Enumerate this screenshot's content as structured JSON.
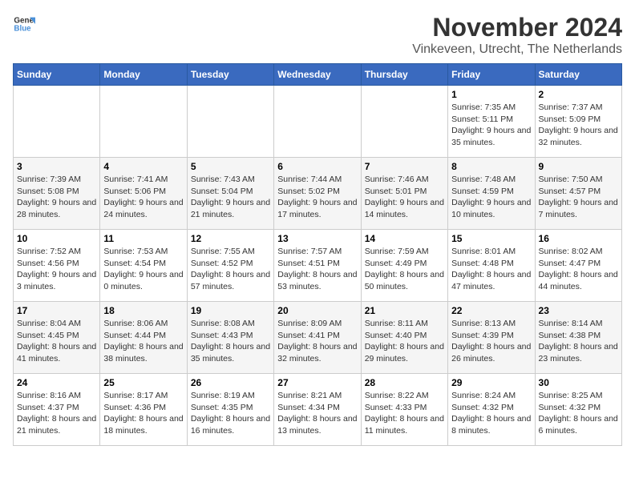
{
  "logo": {
    "general": "General",
    "blue": "Blue"
  },
  "title": "November 2024",
  "subtitle": "Vinkeveen, Utrecht, The Netherlands",
  "days_of_week": [
    "Sunday",
    "Monday",
    "Tuesday",
    "Wednesday",
    "Thursday",
    "Friday",
    "Saturday"
  ],
  "weeks": [
    [
      {
        "day": "",
        "info": ""
      },
      {
        "day": "",
        "info": ""
      },
      {
        "day": "",
        "info": ""
      },
      {
        "day": "",
        "info": ""
      },
      {
        "day": "",
        "info": ""
      },
      {
        "day": "1",
        "info": "Sunrise: 7:35 AM\nSunset: 5:11 PM\nDaylight: 9 hours and 35 minutes."
      },
      {
        "day": "2",
        "info": "Sunrise: 7:37 AM\nSunset: 5:09 PM\nDaylight: 9 hours and 32 minutes."
      }
    ],
    [
      {
        "day": "3",
        "info": "Sunrise: 7:39 AM\nSunset: 5:08 PM\nDaylight: 9 hours and 28 minutes."
      },
      {
        "day": "4",
        "info": "Sunrise: 7:41 AM\nSunset: 5:06 PM\nDaylight: 9 hours and 24 minutes."
      },
      {
        "day": "5",
        "info": "Sunrise: 7:43 AM\nSunset: 5:04 PM\nDaylight: 9 hours and 21 minutes."
      },
      {
        "day": "6",
        "info": "Sunrise: 7:44 AM\nSunset: 5:02 PM\nDaylight: 9 hours and 17 minutes."
      },
      {
        "day": "7",
        "info": "Sunrise: 7:46 AM\nSunset: 5:01 PM\nDaylight: 9 hours and 14 minutes."
      },
      {
        "day": "8",
        "info": "Sunrise: 7:48 AM\nSunset: 4:59 PM\nDaylight: 9 hours and 10 minutes."
      },
      {
        "day": "9",
        "info": "Sunrise: 7:50 AM\nSunset: 4:57 PM\nDaylight: 9 hours and 7 minutes."
      }
    ],
    [
      {
        "day": "10",
        "info": "Sunrise: 7:52 AM\nSunset: 4:56 PM\nDaylight: 9 hours and 3 minutes."
      },
      {
        "day": "11",
        "info": "Sunrise: 7:53 AM\nSunset: 4:54 PM\nDaylight: 9 hours and 0 minutes."
      },
      {
        "day": "12",
        "info": "Sunrise: 7:55 AM\nSunset: 4:52 PM\nDaylight: 8 hours and 57 minutes."
      },
      {
        "day": "13",
        "info": "Sunrise: 7:57 AM\nSunset: 4:51 PM\nDaylight: 8 hours and 53 minutes."
      },
      {
        "day": "14",
        "info": "Sunrise: 7:59 AM\nSunset: 4:49 PM\nDaylight: 8 hours and 50 minutes."
      },
      {
        "day": "15",
        "info": "Sunrise: 8:01 AM\nSunset: 4:48 PM\nDaylight: 8 hours and 47 minutes."
      },
      {
        "day": "16",
        "info": "Sunrise: 8:02 AM\nSunset: 4:47 PM\nDaylight: 8 hours and 44 minutes."
      }
    ],
    [
      {
        "day": "17",
        "info": "Sunrise: 8:04 AM\nSunset: 4:45 PM\nDaylight: 8 hours and 41 minutes."
      },
      {
        "day": "18",
        "info": "Sunrise: 8:06 AM\nSunset: 4:44 PM\nDaylight: 8 hours and 38 minutes."
      },
      {
        "day": "19",
        "info": "Sunrise: 8:08 AM\nSunset: 4:43 PM\nDaylight: 8 hours and 35 minutes."
      },
      {
        "day": "20",
        "info": "Sunrise: 8:09 AM\nSunset: 4:41 PM\nDaylight: 8 hours and 32 minutes."
      },
      {
        "day": "21",
        "info": "Sunrise: 8:11 AM\nSunset: 4:40 PM\nDaylight: 8 hours and 29 minutes."
      },
      {
        "day": "22",
        "info": "Sunrise: 8:13 AM\nSunset: 4:39 PM\nDaylight: 8 hours and 26 minutes."
      },
      {
        "day": "23",
        "info": "Sunrise: 8:14 AM\nSunset: 4:38 PM\nDaylight: 8 hours and 23 minutes."
      }
    ],
    [
      {
        "day": "24",
        "info": "Sunrise: 8:16 AM\nSunset: 4:37 PM\nDaylight: 8 hours and 21 minutes."
      },
      {
        "day": "25",
        "info": "Sunrise: 8:17 AM\nSunset: 4:36 PM\nDaylight: 8 hours and 18 minutes."
      },
      {
        "day": "26",
        "info": "Sunrise: 8:19 AM\nSunset: 4:35 PM\nDaylight: 8 hours and 16 minutes."
      },
      {
        "day": "27",
        "info": "Sunrise: 8:21 AM\nSunset: 4:34 PM\nDaylight: 8 hours and 13 minutes."
      },
      {
        "day": "28",
        "info": "Sunrise: 8:22 AM\nSunset: 4:33 PM\nDaylight: 8 hours and 11 minutes."
      },
      {
        "day": "29",
        "info": "Sunrise: 8:24 AM\nSunset: 4:32 PM\nDaylight: 8 hours and 8 minutes."
      },
      {
        "day": "30",
        "info": "Sunrise: 8:25 AM\nSunset: 4:32 PM\nDaylight: 8 hours and 6 minutes."
      }
    ]
  ]
}
